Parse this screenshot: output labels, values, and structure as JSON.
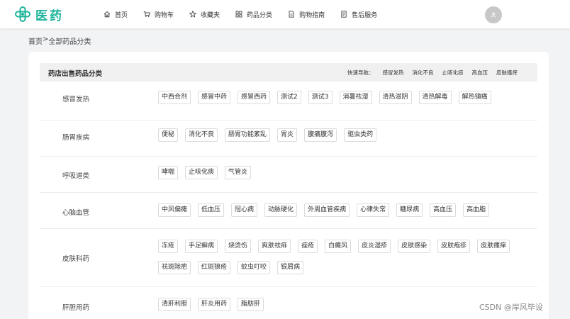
{
  "header": {
    "logo_text": "医药",
    "nav": [
      {
        "label": "首页",
        "icon": "home-icon"
      },
      {
        "label": "购物车",
        "icon": "cart-icon"
      },
      {
        "label": "收藏夹",
        "icon": "star-icon"
      },
      {
        "label": "药品分类",
        "icon": "grid-icon"
      },
      {
        "label": "购物指南",
        "icon": "document-icon"
      },
      {
        "label": "售后服务",
        "icon": "service-icon"
      }
    ],
    "avatar_icon": "user-icon"
  },
  "breadcrumb": {
    "home": "首页",
    "separator": ">",
    "current": "全部药品分类"
  },
  "card": {
    "title": "药店出售药品分类",
    "quick_nav_label": "快速导航：",
    "quick_nav": [
      "感冒发热",
      "消化不良",
      "止咳化痰",
      "高血压",
      "皮肤瘙痒"
    ]
  },
  "categories": [
    {
      "name": "感冒发热",
      "tags": [
        "中西合剂",
        "感冒中药",
        "感冒西药",
        "测试2",
        "测试3",
        "消暑祛湿",
        "清热滋阴",
        "清热解毒",
        "解热镇痛"
      ]
    },
    {
      "name": "肠胃疾病",
      "tags": [
        "便秘",
        "消化不良",
        "肠胃功能紊乱",
        "胃炎",
        "腹痛腹泻",
        "驱虫类药"
      ]
    },
    {
      "name": "呼吸道类",
      "tags": [
        "哮喘",
        "止咳化痰",
        "气管炎"
      ]
    },
    {
      "name": "心脑血管",
      "tags": [
        "中风偏瘫",
        "低血压",
        "冠心病",
        "动脉硬化",
        "外周血管疾病",
        "心律失常",
        "糖尿病",
        "高血压",
        "高血脂"
      ]
    },
    {
      "name": "皮肤科药",
      "tags": [
        "冻疮",
        "手足癣病",
        "烧烫伤",
        "爽肤祛痱",
        "痤疮",
        "白癜风",
        "皮炎湿疹",
        "皮肤感染",
        "皮肤疱疹",
        "皮肤瘙痒",
        "祛斑除疤",
        "红斑狼疮",
        "蚊虫叮咬",
        "银屑病"
      ]
    },
    {
      "name": "肝胆用药",
      "tags": [
        "清肝利胆",
        "肝炎用药",
        "脂肪肝"
      ]
    }
  ],
  "watermark": "CSDN @岸风毕设",
  "colors": {
    "brand": "#1bb39a",
    "page_bg": "#f2f3f5"
  }
}
